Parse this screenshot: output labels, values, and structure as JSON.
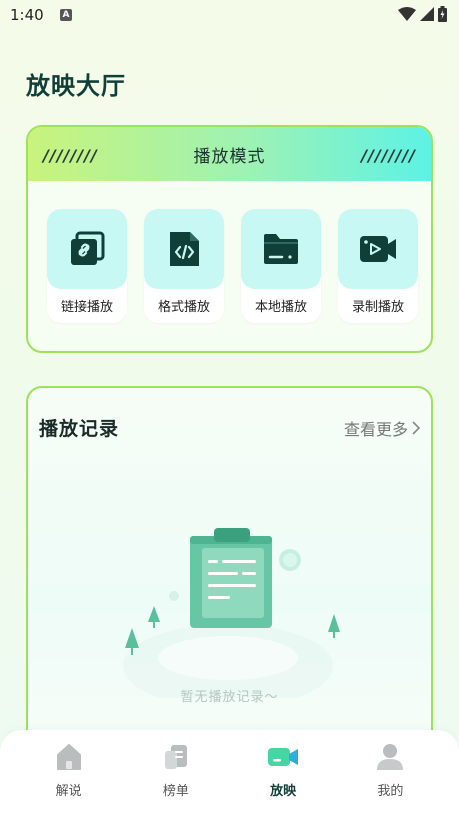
{
  "status": {
    "time": "1:40",
    "badge": "A"
  },
  "page": {
    "title": "放映大厅"
  },
  "play_mode": {
    "title": "播放模式",
    "decor": "////////",
    "items": [
      {
        "label": "链接播放",
        "icon": "link-icon"
      },
      {
        "label": "格式播放",
        "icon": "code-file-icon"
      },
      {
        "label": "本地播放",
        "icon": "folder-icon"
      },
      {
        "label": "录制播放",
        "icon": "video-camera-icon"
      }
    ]
  },
  "history": {
    "title": "播放记录",
    "more": "查看更多",
    "empty": "暂无播放记录～"
  },
  "tabs": [
    {
      "label": "解说",
      "icon": "home-icon"
    },
    {
      "label": "榜单",
      "icon": "list-icon"
    },
    {
      "label": "放映",
      "icon": "camera-icon"
    },
    {
      "label": "我的",
      "icon": "user-icon"
    }
  ],
  "colors": {
    "accent": "#0f3f38",
    "border": "#9be35a",
    "tile": "#c8f8f4"
  }
}
